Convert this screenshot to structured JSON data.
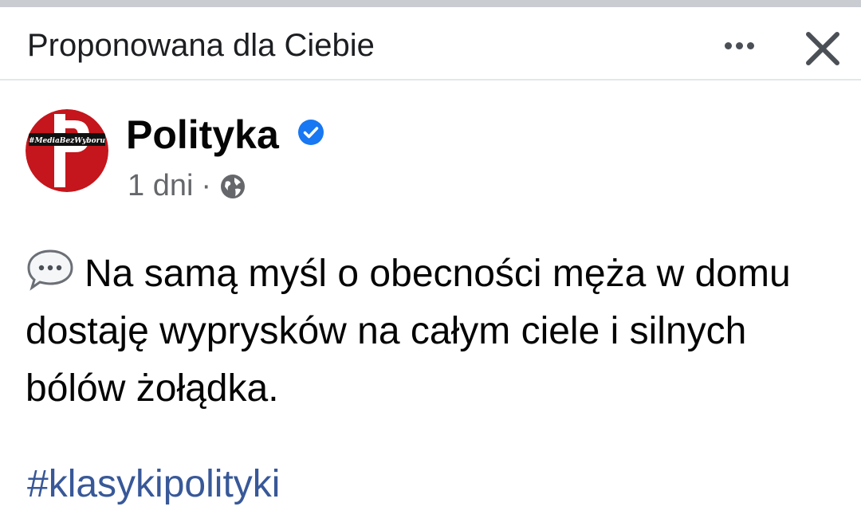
{
  "header": {
    "title": "Proponowana dla Ciebie",
    "more_icon": "more-dots-icon",
    "close_icon": "close-icon"
  },
  "post": {
    "author": "Polityka",
    "avatar_tag": "#MediaBezWyboru",
    "verified_icon": "verified-badge-icon",
    "timestamp": "1 dni",
    "separator": "·",
    "audience_icon": "globe-icon",
    "emoji_icon": "speech-bubble-icon",
    "text": "Na samą myśl o obecności męża w domu dostaję wyprysków na całym ciele i silnych bólów żołądka.",
    "hashtag": "#klasykipolityki"
  },
  "colors": {
    "avatar_red": "#c4161c",
    "verified_blue": "#1877f2",
    "hashtag_blue": "#385898",
    "meta_gray": "#65676b"
  }
}
